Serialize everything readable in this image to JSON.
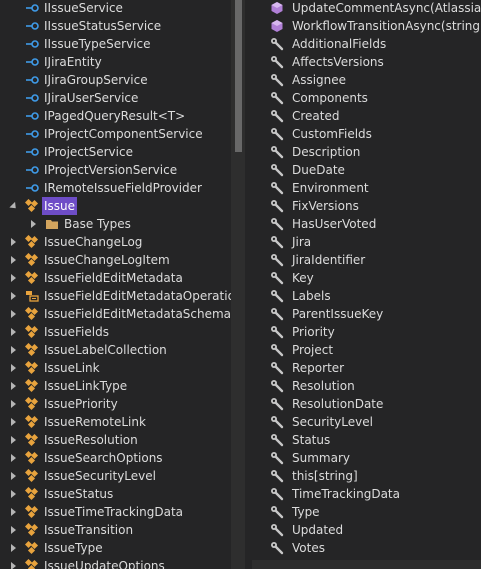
{
  "tree": {
    "items": [
      {
        "label": "IIssueService",
        "kind": "interface",
        "indent": 0,
        "expander": "none"
      },
      {
        "label": "IIssueStatusService",
        "kind": "interface",
        "indent": 0,
        "expander": "none"
      },
      {
        "label": "IIssueTypeService",
        "kind": "interface",
        "indent": 0,
        "expander": "none"
      },
      {
        "label": "IJiraEntity",
        "kind": "interface",
        "indent": 0,
        "expander": "none"
      },
      {
        "label": "IJiraGroupService",
        "kind": "interface",
        "indent": 0,
        "expander": "none"
      },
      {
        "label": "IJiraUserService",
        "kind": "interface",
        "indent": 0,
        "expander": "none"
      },
      {
        "label": "IPagedQueryResult<T>",
        "kind": "interface",
        "indent": 0,
        "expander": "none"
      },
      {
        "label": "IProjectComponentService",
        "kind": "interface",
        "indent": 0,
        "expander": "none"
      },
      {
        "label": "IProjectService",
        "kind": "interface",
        "indent": 0,
        "expander": "none"
      },
      {
        "label": "IProjectVersionService",
        "kind": "interface",
        "indent": 0,
        "expander": "none"
      },
      {
        "label": "IRemoteIssueFieldProvider",
        "kind": "interface",
        "indent": 0,
        "expander": "none"
      },
      {
        "label": "Issue",
        "kind": "class",
        "indent": 0,
        "expander": "expanded",
        "selected": true
      },
      {
        "label": "Base Types",
        "kind": "folder",
        "indent": 1,
        "expander": "collapsed"
      },
      {
        "label": "IssueChangeLog",
        "kind": "class",
        "indent": 0,
        "expander": "collapsed"
      },
      {
        "label": "IssueChangeLogItem",
        "kind": "class",
        "indent": 0,
        "expander": "collapsed"
      },
      {
        "label": "IssueFieldEditMetadata",
        "kind": "class",
        "indent": 0,
        "expander": "collapsed"
      },
      {
        "label": "IssueFieldEditMetadataOperation",
        "kind": "enum",
        "indent": 0,
        "expander": "collapsed"
      },
      {
        "label": "IssueFieldEditMetadataSchema",
        "kind": "class",
        "indent": 0,
        "expander": "collapsed"
      },
      {
        "label": "IssueFields",
        "kind": "class",
        "indent": 0,
        "expander": "collapsed"
      },
      {
        "label": "IssueLabelCollection",
        "kind": "class",
        "indent": 0,
        "expander": "collapsed"
      },
      {
        "label": "IssueLink",
        "kind": "class",
        "indent": 0,
        "expander": "collapsed"
      },
      {
        "label": "IssueLinkType",
        "kind": "class",
        "indent": 0,
        "expander": "collapsed"
      },
      {
        "label": "IssuePriority",
        "kind": "class",
        "indent": 0,
        "expander": "collapsed"
      },
      {
        "label": "IssueRemoteLink",
        "kind": "class",
        "indent": 0,
        "expander": "collapsed"
      },
      {
        "label": "IssueResolution",
        "kind": "class",
        "indent": 0,
        "expander": "collapsed"
      },
      {
        "label": "IssueSearchOptions",
        "kind": "class",
        "indent": 0,
        "expander": "collapsed"
      },
      {
        "label": "IssueSecurityLevel",
        "kind": "class",
        "indent": 0,
        "expander": "collapsed"
      },
      {
        "label": "IssueStatus",
        "kind": "class",
        "indent": 0,
        "expander": "collapsed"
      },
      {
        "label": "IssueTimeTrackingData",
        "kind": "class",
        "indent": 0,
        "expander": "collapsed"
      },
      {
        "label": "IssueTransition",
        "kind": "class",
        "indent": 0,
        "expander": "collapsed"
      },
      {
        "label": "IssueType",
        "kind": "class",
        "indent": 0,
        "expander": "collapsed"
      },
      {
        "label": "IssueUpdateOptions",
        "kind": "class",
        "indent": 0,
        "expander": "collapsed"
      }
    ]
  },
  "members": {
    "items": [
      {
        "label": "UpdateCommentAsync(Atlassian.Jira",
        "kind": "method"
      },
      {
        "label": "WorkflowTransitionAsync(string, Atl",
        "kind": "method"
      },
      {
        "label": "AdditionalFields",
        "kind": "property"
      },
      {
        "label": "AffectsVersions",
        "kind": "property"
      },
      {
        "label": "Assignee",
        "kind": "property"
      },
      {
        "label": "Components",
        "kind": "property"
      },
      {
        "label": "Created",
        "kind": "property"
      },
      {
        "label": "CustomFields",
        "kind": "property"
      },
      {
        "label": "Description",
        "kind": "property"
      },
      {
        "label": "DueDate",
        "kind": "property"
      },
      {
        "label": "Environment",
        "kind": "property"
      },
      {
        "label": "FixVersions",
        "kind": "property"
      },
      {
        "label": "HasUserVoted",
        "kind": "property"
      },
      {
        "label": "Jira",
        "kind": "property"
      },
      {
        "label": "JiraIdentifier",
        "kind": "property"
      },
      {
        "label": "Key",
        "kind": "property"
      },
      {
        "label": "Labels",
        "kind": "property"
      },
      {
        "label": "ParentIssueKey",
        "kind": "property"
      },
      {
        "label": "Priority",
        "kind": "property"
      },
      {
        "label": "Project",
        "kind": "property"
      },
      {
        "label": "Reporter",
        "kind": "property"
      },
      {
        "label": "Resolution",
        "kind": "property"
      },
      {
        "label": "ResolutionDate",
        "kind": "property"
      },
      {
        "label": "SecurityLevel",
        "kind": "property"
      },
      {
        "label": "Status",
        "kind": "property"
      },
      {
        "label": "Summary",
        "kind": "property"
      },
      {
        "label": "this[string]",
        "kind": "property"
      },
      {
        "label": "TimeTrackingData",
        "kind": "property"
      },
      {
        "label": "Type",
        "kind": "property"
      },
      {
        "label": "Updated",
        "kind": "property"
      },
      {
        "label": "Votes",
        "kind": "property"
      }
    ]
  },
  "icons": {
    "interface": "interface-icon",
    "class": "class-icon",
    "enum": "enum-icon",
    "folder": "folder-icon",
    "method": "method-icon",
    "property": "wrench-property-icon"
  },
  "colors": {
    "interface": "#3f9be8",
    "class": "#e8a33d",
    "folder": "#d2a45e",
    "method": "#b180d7",
    "property": "#c8c8c8",
    "selection": "#6e4dc7"
  }
}
